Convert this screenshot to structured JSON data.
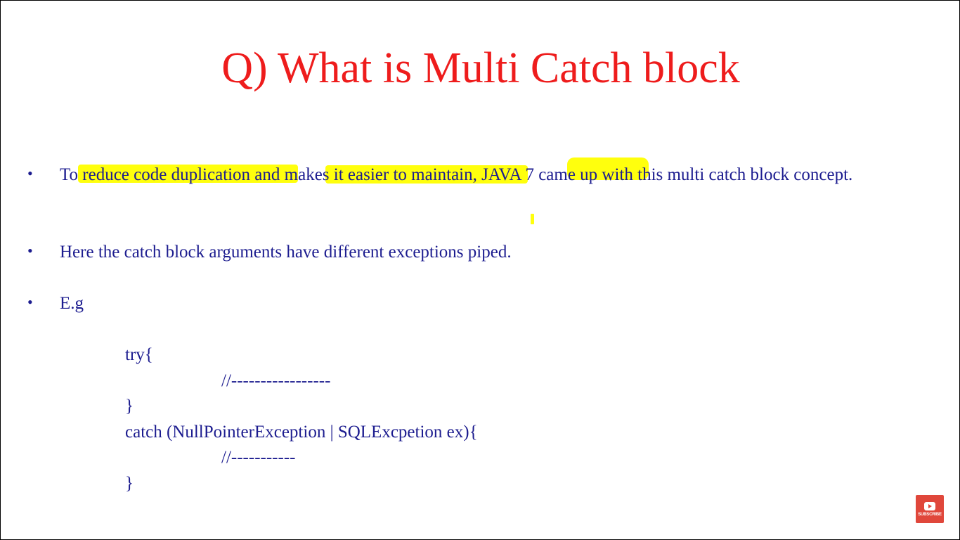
{
  "slide": {
    "title": "Q) What is Multi Catch block",
    "bullets": [
      {
        "marker": "•",
        "text": "To reduce  code duplication and makes it easier to maintain, JAVA 7 came up with this multi catch block concept."
      },
      {
        "marker": "•",
        "text": "Here the catch block arguments have different exceptions piped."
      },
      {
        "marker": "•",
        "text": "E.g"
      }
    ],
    "code": [
      "try{",
      "//-----------------",
      "}",
      "catch (NullPointerException | SQLExcpetion ex){",
      "//-----------",
      "}"
    ],
    "colors": {
      "title": "#ee1c1c",
      "body": "#1c1c8f",
      "highlight": "#ffff00",
      "subscribe": "#e0473b"
    }
  },
  "overlay": {
    "subscribe_icon": "youtube-play-icon",
    "subscribe_label": "SUBSCRIBE"
  }
}
